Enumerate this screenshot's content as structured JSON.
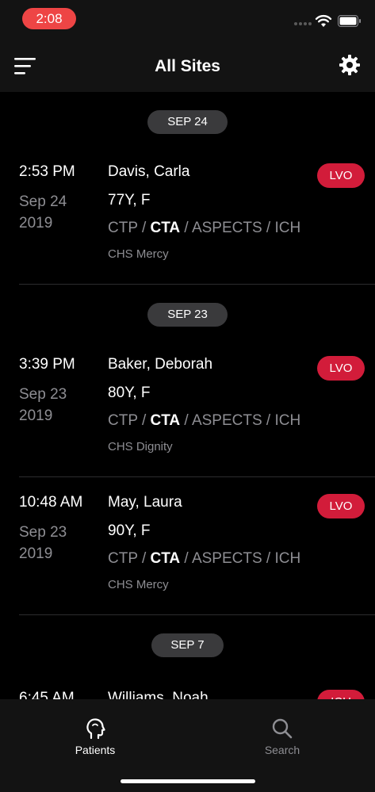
{
  "status_bar": {
    "time": "2:08"
  },
  "header": {
    "title": "All Sites"
  },
  "sections": [
    {
      "date_label": "SEP 24",
      "patients": [
        {
          "time": "2:53 PM",
          "date_line1": "Sep 24",
          "date_line2": "2019",
          "name": "Davis, Carla",
          "age_sex": "77Y, F",
          "studies": [
            "CTP",
            "CTA",
            "ASPECTS",
            "ICH"
          ],
          "highlight_study": "CTA",
          "site": "CHS Mercy",
          "badge": "LVO"
        }
      ]
    },
    {
      "date_label": "SEP 23",
      "patients": [
        {
          "time": "3:39 PM",
          "date_line1": "Sep 23",
          "date_line2": "2019",
          "name": "Baker, Deborah",
          "age_sex": "80Y, F",
          "studies": [
            "CTP",
            "CTA",
            "ASPECTS",
            "ICH"
          ],
          "highlight_study": "CTA",
          "site": "CHS Dignity",
          "badge": "LVO"
        },
        {
          "time": "10:48 AM",
          "date_line1": "Sep 23",
          "date_line2": "2019",
          "name": "May, Laura",
          "age_sex": "90Y, F",
          "studies": [
            "CTP",
            "CTA",
            "ASPECTS",
            "ICH"
          ],
          "highlight_study": "CTA",
          "site": "CHS Mercy",
          "badge": "LVO"
        }
      ]
    },
    {
      "date_label": "SEP 7",
      "patients": [
        {
          "time": "6:45 AM",
          "name": "Williams, Noah",
          "badge": "ICH"
        }
      ]
    }
  ],
  "tabs": [
    {
      "label": "Patients",
      "icon": "head-profile-icon",
      "active": true
    },
    {
      "label": "Search",
      "icon": "search-icon",
      "active": false
    }
  ],
  "colors": {
    "accent_badge": "#d21c3a",
    "status_time_pill": "#ee4545",
    "pill_bg": "#3a3a3c",
    "muted_text": "#8e8e93"
  }
}
